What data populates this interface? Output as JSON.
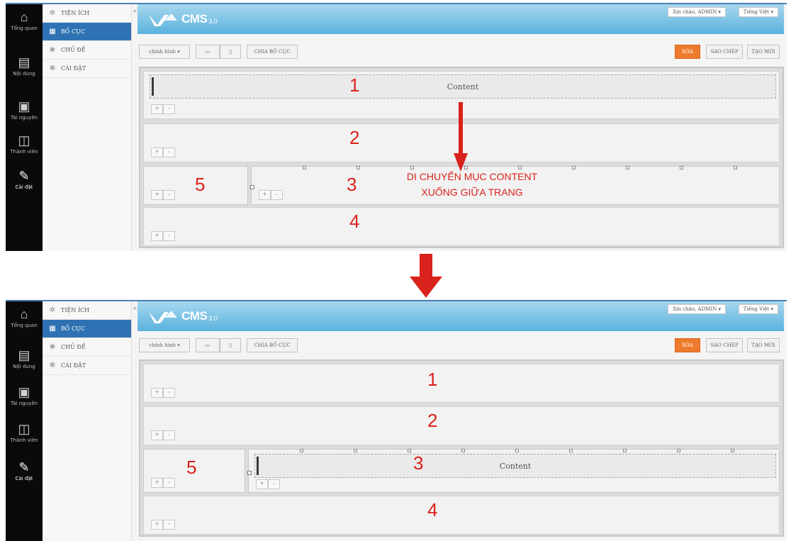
{
  "nav": {
    "items": [
      {
        "label": "Tổng quan",
        "icon": "home-icon"
      },
      {
        "label": "Nội dung",
        "icon": "document-icon"
      },
      {
        "label": "Tài nguyên",
        "icon": "folder-icon"
      },
      {
        "label": "Thành viên",
        "icon": "members-icon"
      },
      {
        "label": "Cài đặt",
        "icon": "wrench-icon"
      }
    ]
  },
  "subnav": {
    "items": [
      {
        "label": "TIỆN ÍCH",
        "icon": "widget-icon"
      },
      {
        "label": "BỐ CỤC",
        "icon": "layout-icon"
      },
      {
        "label": "CHỦ ĐỀ",
        "icon": "theme-icon"
      },
      {
        "label": "CÀI ĐẶT",
        "icon": "settings-icon"
      }
    ]
  },
  "header": {
    "logo_brand": "vnvn",
    "logo_text": "CMS",
    "logo_version": "3.0",
    "greeting": "Xin chào, ADMIN",
    "language": "Tiếng Việt"
  },
  "toolbar": {
    "page_select": "chính hình",
    "desktop_icon": "desktop-icon",
    "mobile_icon": "mobile-icon",
    "split_layout": "CHIA BỐ CỤC",
    "delete": "XÓA",
    "copy": "SAO CHÉP",
    "create": "TẠO MỚI"
  },
  "layout": {
    "rows": [
      "1",
      "2",
      "3",
      "4"
    ],
    "side_cell": "5",
    "content_block": "Content",
    "add_symbol": "+",
    "remove_symbol": "-"
  },
  "annotation": {
    "line1": "DI CHUYỂN MỤC CONTENT",
    "line2": "XUỐNG GIỮA TRANG"
  },
  "colors": {
    "accent": "#2f72b3",
    "header": "#5bb2de",
    "danger": "#ee7a2d",
    "annotation": "#d9221b"
  }
}
